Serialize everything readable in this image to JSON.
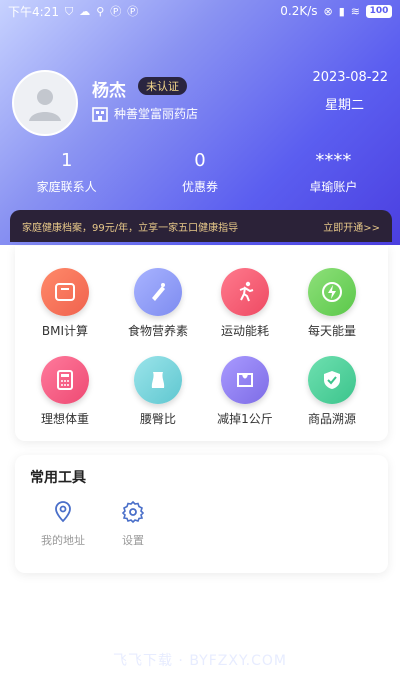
{
  "status": {
    "time": "下午4:21",
    "network_speed": "0.2K/s",
    "battery": "100"
  },
  "user": {
    "name": "杨杰",
    "verify_badge": "未认证",
    "store": "种善堂富丽药店",
    "date": "2023-08-22",
    "weekday": "星期二"
  },
  "stats": [
    {
      "value": "1",
      "label": "家庭联系人"
    },
    {
      "value": "0",
      "label": "优惠券"
    },
    {
      "value": "****",
      "label": "卓瑜账户"
    }
  ],
  "promo": {
    "text": "家庭健康档案，99元/年，立享一家五口健康指导",
    "action": "立即开通>>"
  },
  "tools": [
    {
      "label": "BMI计算",
      "icon": "scale-icon",
      "color": "#f0624e"
    },
    {
      "label": "食物营养素",
      "icon": "food-icon",
      "color": "#7e8cf0"
    },
    {
      "label": "运动能耗",
      "icon": "running-icon",
      "color": "#ee4a63"
    },
    {
      "label": "每天能量",
      "icon": "energy-icon",
      "color": "#5bc84a"
    },
    {
      "label": "理想体重",
      "icon": "calculator-icon",
      "color": "#ee4a73"
    },
    {
      "label": "腰臀比",
      "icon": "waist-icon",
      "color": "#5fc7d0"
    },
    {
      "label": "减掉1公斤",
      "icon": "slim-icon",
      "color": "#7d6ce6"
    },
    {
      "label": "商品溯源",
      "icon": "shield-check-icon",
      "color": "#3cc48c"
    }
  ],
  "common_tools": {
    "title": "常用工具",
    "items": [
      {
        "label": "我的地址",
        "icon": "location-icon"
      },
      {
        "label": "设置",
        "icon": "gear-icon"
      }
    ]
  },
  "watermark": "飞飞下载 · BYFZXY.COM"
}
